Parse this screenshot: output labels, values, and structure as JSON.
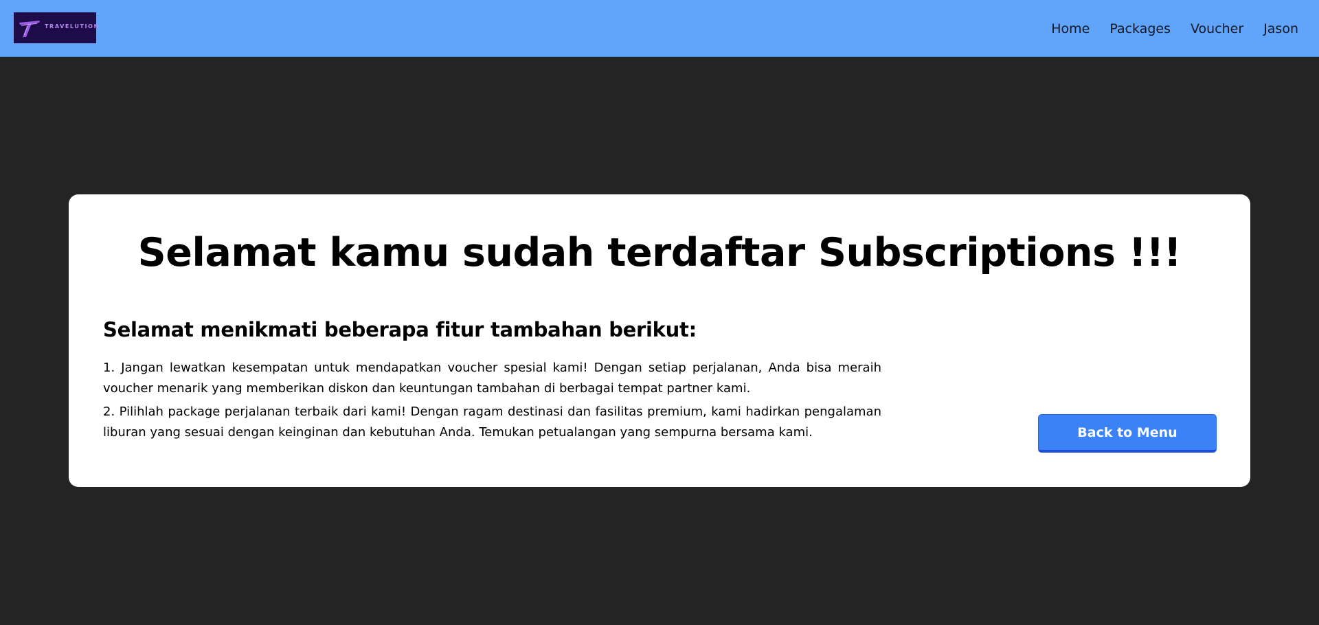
{
  "navbar": {
    "logo": {
      "text": "TRAVELUTION",
      "icon": "t-letter-logo-icon",
      "bg_color": "#1e0b4a",
      "accent_color": "#b88af0"
    },
    "links": [
      {
        "label": "Home"
      },
      {
        "label": "Packages"
      },
      {
        "label": "Voucher"
      },
      {
        "label": "Jason"
      }
    ],
    "bg_color": "#60a5fa"
  },
  "card": {
    "headline": "Selamat kamu sudah terdaftar Subscriptions !!!",
    "subheading": "Selamat menikmati beberapa fitur tambahan berikut:",
    "features": [
      "1. Jangan lewatkan kesempatan untuk mendapatkan voucher spesial kami! Dengan setiap perjalanan, Anda bisa meraih voucher menarik yang memberikan diskon dan keuntungan tambahan di berbagai tempat partner kami.",
      "2. Pilihlah package perjalanan terbaik dari kami! Dengan ragam destinasi dan fasilitas premium, kami hadirkan pengalaman liburan yang sesuai dengan keinginan dan kebutuhan Anda. Temukan petualangan yang sempurna bersama kami."
    ],
    "back_button_label": "Back to Menu",
    "button_color": "#3b82f6"
  },
  "page_bg_color": "#242424"
}
